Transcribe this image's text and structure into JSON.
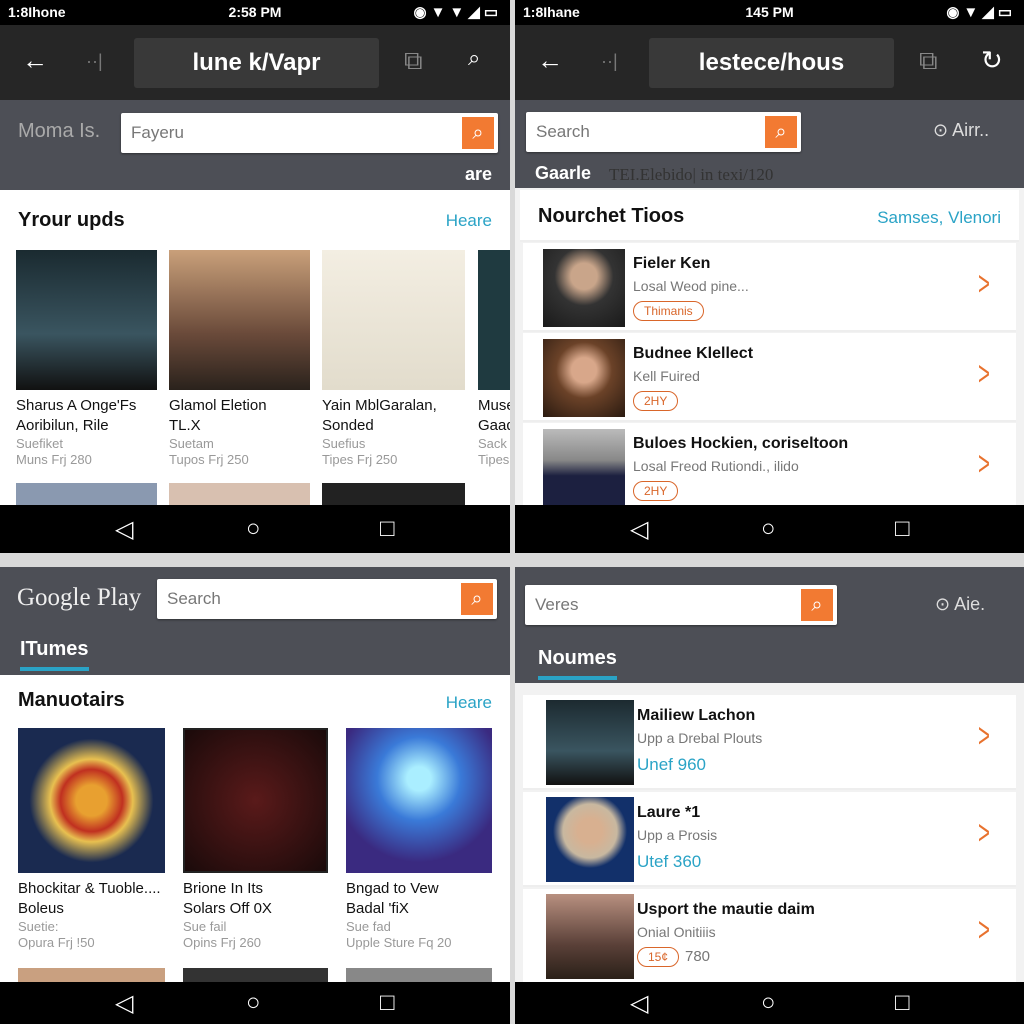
{
  "colors": {
    "accent": "#f27a32",
    "link": "#2aa3c6",
    "header": "#4d4f56"
  },
  "tl": {
    "status": {
      "carrier": "1:8Ihone",
      "time": "2:58 PM"
    },
    "url": "lune k/Vapr",
    "label": "Moma Is.",
    "search_value": "Fayeru",
    "extra": "are",
    "section": "Yrour upds",
    "more": "Heare",
    "tiles": [
      {
        "t1": "Sharus A Onge'Fs",
        "t2": "Aoribilun, Rile",
        "s1": "Suefiket",
        "s2": "Muns Frj 280"
      },
      {
        "t1": "Glamol Eletion",
        "t2": "TL.X",
        "s1": "Suetam",
        "s2": "Tupos Frj 250"
      },
      {
        "t1": "Yain MblGaralan,",
        "t2": "Sonded",
        "s1": "Suefius",
        "s2": "Tipes Frj 250"
      },
      {
        "t1": "Muse",
        "t2": "Gaad",
        "s1": "Sack",
        "s2": "Tipes"
      }
    ]
  },
  "tr": {
    "status": {
      "carrier": "1:8Ihane",
      "time": "145 PM"
    },
    "url": "lestece/hous",
    "search_placeholder": "Search",
    "side": "Airr..",
    "sub_label": "Gaarle",
    "sub_text": "TEI.Elebido| in texi/120",
    "section": "Nourchet Tioos",
    "more": "Samses, Vlenori",
    "rows": [
      {
        "name": "Fieler Ken",
        "sub": "Losal Weod pine...",
        "badge": "Thimanis"
      },
      {
        "name": "Budnee Klellect",
        "sub": "Kell Fuired",
        "badge": "2HY"
      },
      {
        "name": "Buloes Hockien, coriseltoon",
        "sub": "Losal Freod Rutiondi., ilido",
        "badge": "2HY"
      }
    ]
  },
  "bl": {
    "logo": "Google Play",
    "search_placeholder": "Search",
    "tab": "ITumes",
    "section": "Manuotairs",
    "more": "Heare",
    "tiles": [
      {
        "t1": "Bhockitar & Tuoble....",
        "t2": "Boleus",
        "s1": "Suetie:",
        "s2": "Opura Frj !50"
      },
      {
        "t1": "Brione In Its",
        "t2": "Solars Off 0X",
        "s1": "Sue fail",
        "s2": "Opins Frj 260"
      },
      {
        "t1": "Bngad to Vew",
        "t2": "Badal 'fiX",
        "s1": "Sue fad",
        "s2": "Upple Sture Fq 20"
      }
    ]
  },
  "br": {
    "search_value": "Veres",
    "side": "Aie.",
    "tab": "Noumes",
    "rows": [
      {
        "name": "Mailiew Lachon",
        "sub": "Upp a Drebal Plouts",
        "price": "Unef 960"
      },
      {
        "name": "Laure *1",
        "sub": "Upp a Prosis",
        "price": "Utef 360"
      },
      {
        "name": "Usport the mautie daim",
        "sub": "Onial Onitiiis",
        "badge": "15¢",
        "price": "780"
      }
    ]
  }
}
